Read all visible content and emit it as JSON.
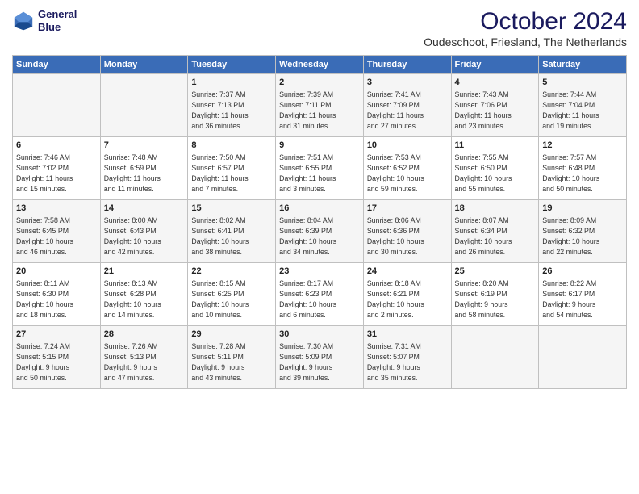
{
  "header": {
    "logo_line1": "General",
    "logo_line2": "Blue",
    "title": "October 2024",
    "subtitle": "Oudeschoot, Friesland, The Netherlands"
  },
  "days_of_week": [
    "Sunday",
    "Monday",
    "Tuesday",
    "Wednesday",
    "Thursday",
    "Friday",
    "Saturday"
  ],
  "weeks": [
    [
      {
        "day": "",
        "content": ""
      },
      {
        "day": "",
        "content": ""
      },
      {
        "day": "1",
        "content": "Sunrise: 7:37 AM\nSunset: 7:13 PM\nDaylight: 11 hours\nand 36 minutes."
      },
      {
        "day": "2",
        "content": "Sunrise: 7:39 AM\nSunset: 7:11 PM\nDaylight: 11 hours\nand 31 minutes."
      },
      {
        "day": "3",
        "content": "Sunrise: 7:41 AM\nSunset: 7:09 PM\nDaylight: 11 hours\nand 27 minutes."
      },
      {
        "day": "4",
        "content": "Sunrise: 7:43 AM\nSunset: 7:06 PM\nDaylight: 11 hours\nand 23 minutes."
      },
      {
        "day": "5",
        "content": "Sunrise: 7:44 AM\nSunset: 7:04 PM\nDaylight: 11 hours\nand 19 minutes."
      }
    ],
    [
      {
        "day": "6",
        "content": "Sunrise: 7:46 AM\nSunset: 7:02 PM\nDaylight: 11 hours\nand 15 minutes."
      },
      {
        "day": "7",
        "content": "Sunrise: 7:48 AM\nSunset: 6:59 PM\nDaylight: 11 hours\nand 11 minutes."
      },
      {
        "day": "8",
        "content": "Sunrise: 7:50 AM\nSunset: 6:57 PM\nDaylight: 11 hours\nand 7 minutes."
      },
      {
        "day": "9",
        "content": "Sunrise: 7:51 AM\nSunset: 6:55 PM\nDaylight: 11 hours\nand 3 minutes."
      },
      {
        "day": "10",
        "content": "Sunrise: 7:53 AM\nSunset: 6:52 PM\nDaylight: 10 hours\nand 59 minutes."
      },
      {
        "day": "11",
        "content": "Sunrise: 7:55 AM\nSunset: 6:50 PM\nDaylight: 10 hours\nand 55 minutes."
      },
      {
        "day": "12",
        "content": "Sunrise: 7:57 AM\nSunset: 6:48 PM\nDaylight: 10 hours\nand 50 minutes."
      }
    ],
    [
      {
        "day": "13",
        "content": "Sunrise: 7:58 AM\nSunset: 6:45 PM\nDaylight: 10 hours\nand 46 minutes."
      },
      {
        "day": "14",
        "content": "Sunrise: 8:00 AM\nSunset: 6:43 PM\nDaylight: 10 hours\nand 42 minutes."
      },
      {
        "day": "15",
        "content": "Sunrise: 8:02 AM\nSunset: 6:41 PM\nDaylight: 10 hours\nand 38 minutes."
      },
      {
        "day": "16",
        "content": "Sunrise: 8:04 AM\nSunset: 6:39 PM\nDaylight: 10 hours\nand 34 minutes."
      },
      {
        "day": "17",
        "content": "Sunrise: 8:06 AM\nSunset: 6:36 PM\nDaylight: 10 hours\nand 30 minutes."
      },
      {
        "day": "18",
        "content": "Sunrise: 8:07 AM\nSunset: 6:34 PM\nDaylight: 10 hours\nand 26 minutes."
      },
      {
        "day": "19",
        "content": "Sunrise: 8:09 AM\nSunset: 6:32 PM\nDaylight: 10 hours\nand 22 minutes."
      }
    ],
    [
      {
        "day": "20",
        "content": "Sunrise: 8:11 AM\nSunset: 6:30 PM\nDaylight: 10 hours\nand 18 minutes."
      },
      {
        "day": "21",
        "content": "Sunrise: 8:13 AM\nSunset: 6:28 PM\nDaylight: 10 hours\nand 14 minutes."
      },
      {
        "day": "22",
        "content": "Sunrise: 8:15 AM\nSunset: 6:25 PM\nDaylight: 10 hours\nand 10 minutes."
      },
      {
        "day": "23",
        "content": "Sunrise: 8:17 AM\nSunset: 6:23 PM\nDaylight: 10 hours\nand 6 minutes."
      },
      {
        "day": "24",
        "content": "Sunrise: 8:18 AM\nSunset: 6:21 PM\nDaylight: 10 hours\nand 2 minutes."
      },
      {
        "day": "25",
        "content": "Sunrise: 8:20 AM\nSunset: 6:19 PM\nDaylight: 9 hours\nand 58 minutes."
      },
      {
        "day": "26",
        "content": "Sunrise: 8:22 AM\nSunset: 6:17 PM\nDaylight: 9 hours\nand 54 minutes."
      }
    ],
    [
      {
        "day": "27",
        "content": "Sunrise: 7:24 AM\nSunset: 5:15 PM\nDaylight: 9 hours\nand 50 minutes."
      },
      {
        "day": "28",
        "content": "Sunrise: 7:26 AM\nSunset: 5:13 PM\nDaylight: 9 hours\nand 47 minutes."
      },
      {
        "day": "29",
        "content": "Sunrise: 7:28 AM\nSunset: 5:11 PM\nDaylight: 9 hours\nand 43 minutes."
      },
      {
        "day": "30",
        "content": "Sunrise: 7:30 AM\nSunset: 5:09 PM\nDaylight: 9 hours\nand 39 minutes."
      },
      {
        "day": "31",
        "content": "Sunrise: 7:31 AM\nSunset: 5:07 PM\nDaylight: 9 hours\nand 35 minutes."
      },
      {
        "day": "",
        "content": ""
      },
      {
        "day": "",
        "content": ""
      }
    ]
  ]
}
